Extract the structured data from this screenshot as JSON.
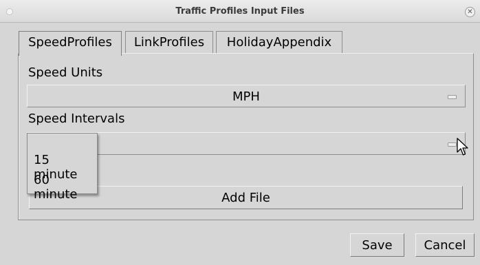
{
  "window": {
    "title": "Traffic Profiles Input Files"
  },
  "icons": {
    "close": "close-icon",
    "window_menu": "window-menu-dot-icon",
    "cursor": "mouse-pointer-icon",
    "combo_indicator": "option-menu-indicator-icon"
  },
  "tabs": [
    {
      "label": "SpeedProfiles",
      "active": true
    },
    {
      "label": "LinkProfiles",
      "active": false
    },
    {
      "label": "HolidayAppendix",
      "active": false
    }
  ],
  "speed_units": {
    "label": "Speed Units",
    "value": "MPH"
  },
  "speed_intervals": {
    "label": "Speed Intervals",
    "value": "",
    "options": [
      "15 minute",
      "60 minute"
    ]
  },
  "add_file_label": "Add File",
  "footer": {
    "save_label": "Save",
    "cancel_label": "Cancel"
  },
  "colors": {
    "background": "#d6d6d6",
    "border": "#8c8c8c",
    "text": "#000000"
  }
}
